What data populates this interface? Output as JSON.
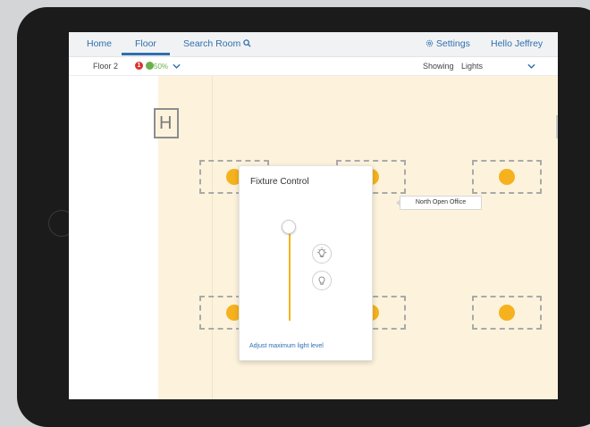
{
  "nav": {
    "home": "Home",
    "floor": "Floor",
    "search_room": "Search Room",
    "settings": "Settings",
    "greeting": "Hello Jeffrey"
  },
  "subbar": {
    "floor_label": "Floor 2",
    "alert_count": "1",
    "energy_percent": "50%",
    "showing_label": "Showing",
    "showing_value": "Lights"
  },
  "popup": {
    "title": "Fixture Control",
    "adjust_link": "Adjust maximum light level",
    "slider_level_percent": 100
  },
  "floorplan": {
    "tooltip": "North Open Office",
    "room_marker": "H"
  },
  "colors": {
    "accent": "#2f6fb0",
    "bulb": "#f5b21e",
    "floor_bg": "#fdf3dc",
    "alert": "#d9322e",
    "energy": "#6ab04c"
  }
}
